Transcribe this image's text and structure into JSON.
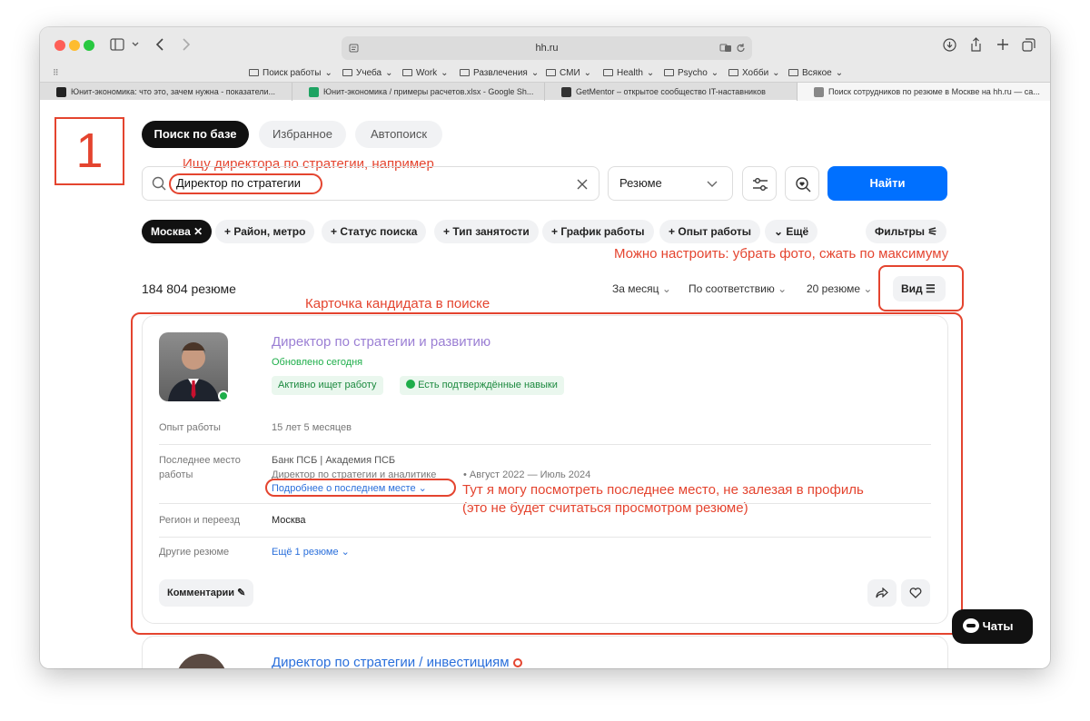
{
  "browser": {
    "url": "hh.ru",
    "bookmarks": [
      "Поиск работы",
      "Учеба",
      "Work",
      "Развлечения",
      "СМИ",
      "Health",
      "Psycho",
      "Хобби",
      "Всякое"
    ],
    "tabs": [
      "Юнит-экономика: что это, зачем нужна - показатели...",
      "Юнит-экономика / примеры расчетов.xlsx - Google Sh...",
      "GetMentor – открытое сообщество IT-наставников",
      "Поиск сотрудников по резюме в Москве на hh.ru — са..."
    ]
  },
  "annotations": {
    "number": "1",
    "search_note": "Ищу директора по стратегии, например",
    "view_note": "Можно настроить: убрать фото, сжать по максимуму",
    "card_note": "Карточка кандидата в поиске",
    "last_place_note_1": "Тут я могу посмотреть последнее место, не залезая в профиль",
    "last_place_note_2": "(это не будет считаться просмотром резюме)"
  },
  "nav": {
    "tab_search": "Поиск по базе",
    "tab_favorites": "Избранное",
    "tab_autosearch": "Автопоиск"
  },
  "search": {
    "value": "Директор по стратегии",
    "type": "Резюме",
    "find_label": "Найти"
  },
  "chips": {
    "city": "Москва",
    "district": "Район, метро",
    "status": "Статус поиска",
    "employment": "Тип занятости",
    "schedule": "График работы",
    "experience": "Опыт работы",
    "more": "Ещё",
    "filters": "Фильтры"
  },
  "results": {
    "count": "184 804 резюме",
    "period": "За месяц",
    "sort": "По соответствию",
    "per_page": "20 резюме",
    "view": "Вид"
  },
  "card": {
    "title": "Директор по стратегии и развитию",
    "updated": "Обновлено сегодня",
    "badge_active": "Активно ищет работу",
    "badge_skills": "Есть подтверждённые навыки",
    "experience_label": "Опыт работы",
    "experience_value": "15 лет 5 месяцев",
    "last_place_label_1": "Последнее место",
    "last_place_label_2": "работы",
    "company": "Банк ПСБ | Академия ПСБ",
    "position": "Директор по стратегии и аналитике",
    "period": "• Август 2022 — Июль 2024",
    "last_place_more": "Подробнее о последнем месте",
    "region_label": "Регион и переезд",
    "region_value": "Москва",
    "other_label": "Другие резюме",
    "other_value": "Ещё 1 резюме",
    "comments": "Комментарии"
  },
  "card2": {
    "title": "Директор по стратегии / инвестициям"
  },
  "chat": {
    "label": "Чаты"
  },
  "colors": {
    "accent": "#0070ff",
    "annotation": "#e4442f",
    "link": "#2a6fdb",
    "online": "#1eae4a"
  }
}
